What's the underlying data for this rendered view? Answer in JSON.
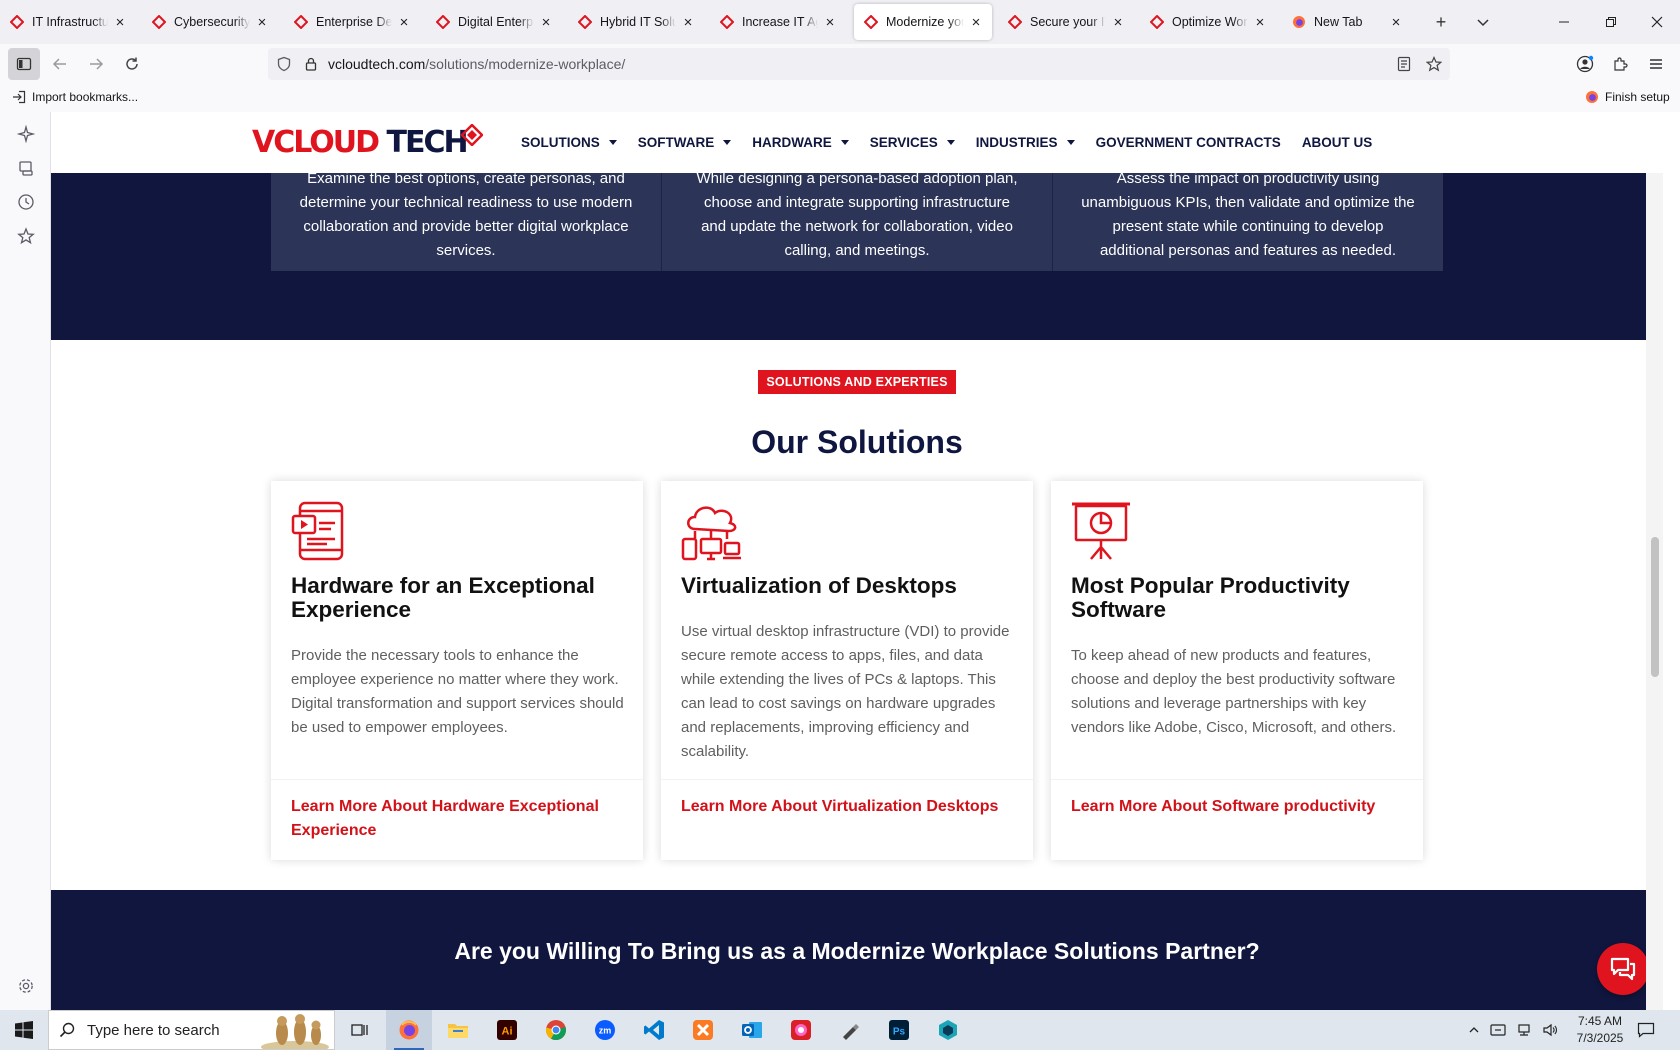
{
  "browser": {
    "tabs": [
      {
        "title": "IT Infrastructure",
        "active": false
      },
      {
        "title": "Cybersecurity Se",
        "active": false
      },
      {
        "title": "Enterprise DevO",
        "active": false
      },
      {
        "title": "Digital Enterpris",
        "active": false
      },
      {
        "title": "Hybrid IT Soluti",
        "active": false
      },
      {
        "title": "Increase IT Agili",
        "active": false
      },
      {
        "title": "Modernize your",
        "active": true
      },
      {
        "title": "Secure your IT V",
        "active": false
      },
      {
        "title": "Optimize Workp",
        "active": false
      },
      {
        "title": "New Tab",
        "active": false
      }
    ],
    "url_host": "vcloudtech.com",
    "url_path": "/solutions/modernize-workplace/",
    "bookmarks": {
      "import_label": "Import bookmarks...",
      "finish_setup": "Finish setup"
    }
  },
  "site": {
    "logo": {
      "part1": "V",
      "part2": "CLOUD",
      "part3": " TECH"
    },
    "menu": [
      {
        "label": "SOLUTIONS",
        "dropdown": true
      },
      {
        "label": "SOFTWARE",
        "dropdown": true
      },
      {
        "label": "HARDWARE",
        "dropdown": true
      },
      {
        "label": "SERVICES",
        "dropdown": true
      },
      {
        "label": "INDUSTRIES",
        "dropdown": true
      },
      {
        "label": "GOVERNMENT CONTRACTS",
        "dropdown": false
      },
      {
        "label": "ABOUT US",
        "dropdown": false
      }
    ],
    "steps": [
      "Examine the best options, create personas, and determine your technical readiness to use modern collaboration and provide better digital workplace services.",
      "While designing a persona-based adoption plan, choose and integrate supporting infrastructure and update the network for collaboration, video calling, and meetings.",
      "Assess the impact on productivity using unambiguous KPIs, then validate and optimize the present state while continuing to develop additional personas and features as needed."
    ],
    "badge": "SOLUTIONS AND EXPERTIES",
    "section_title": "Our Solutions",
    "cards": [
      {
        "icon": "tablet-video-icon",
        "title": "Hardware for an Exceptional Experience",
        "description": "Provide the necessary tools to enhance the employee experience no matter where they work. Digital transformation and support services should be used to empower employees.",
        "link": "Learn More About Hardware Exceptional Experience"
      },
      {
        "icon": "cloud-devices-icon",
        "title": "Virtualization of Desktops",
        "description": "Use virtual desktop infrastructure (VDI) to provide secure remote access to apps, files, and data while extending the lives of PCs & laptops. This can lead to cost savings on hardware upgrades and replacements, improving efficiency and scalability.",
        "link": "Learn More About Virtualization Desktops"
      },
      {
        "icon": "presentation-board-icon",
        "title": "Most Popular Productivity Software",
        "description": "To keep ahead of new products and features, choose and deploy the best productivity software solutions and leverage partnerships with key vendors like Adobe, Cisco, Microsoft, and others.",
        "link": "Learn More About Software productivity"
      }
    ],
    "cta_title": "Are you Willing To Bring us as a Modernize Workplace Solutions Partner?",
    "chat_icon": "chat-bubbles-icon"
  },
  "taskbar": {
    "search_placeholder": "Type here to search",
    "time": "7:45 AM",
    "date": "7/3/2025"
  },
  "colors": {
    "brand_red": "#e0141e",
    "navy": "#10163e",
    "step_box": "#2c3457"
  }
}
